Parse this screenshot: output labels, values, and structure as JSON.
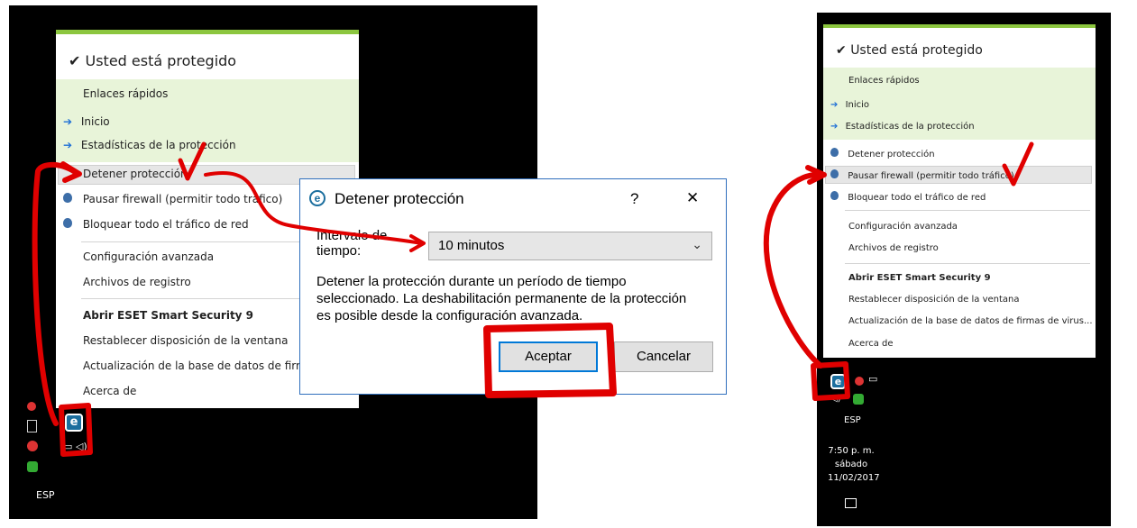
{
  "left_panel": {
    "status": "Usted está protegido",
    "quick_links_title": "Enlaces rápidos",
    "items": [
      {
        "label": "Inicio",
        "icon": "arrow-right-icon"
      },
      {
        "label": "Estadísticas de la protección",
        "icon": "arrow-right-icon"
      },
      {
        "label": "Detener protección",
        "icon": "none"
      },
      {
        "label": "Pausar firewall (permitir todo tráfico)",
        "icon": "shield-icon"
      },
      {
        "label": "Bloquear todo el tráfico de red",
        "icon": "shield-icon"
      },
      {
        "label": "Configuración avanzada"
      },
      {
        "label": "Archivos de registro"
      },
      {
        "label": "Abrir ESET Smart Security 9",
        "bold": true
      },
      {
        "label": "Restablecer disposición de la ventana"
      },
      {
        "label": "Actualización de la base de datos de firmas de"
      },
      {
        "label": "Acerca de"
      }
    ],
    "tray": {
      "language": "ESP",
      "eset_icon": "e"
    }
  },
  "dialog": {
    "title": "Detener protección",
    "help": "?",
    "close": "✕",
    "interval_label_1": "Intervalo de",
    "interval_label_2": "tiempo:",
    "interval_value": "10 minutos",
    "description_1": "Detener la protección durante un período de tiempo",
    "description_2": "seleccionado. La deshabilitación permanente de la protección",
    "description_3": "es posible desde la configuración avanzada.",
    "accept": "Aceptar",
    "cancel": "Cancelar"
  },
  "right_panel": {
    "status": "Usted está protegido",
    "quick_links_title": "Enlaces rápidos",
    "items": [
      {
        "label": "Inicio"
      },
      {
        "label": "Estadísticas de la protección"
      },
      {
        "label": "Detener protección"
      },
      {
        "label": "Pausar firewall (permitir todo tráfico)"
      },
      {
        "label": "Bloquear todo el tráfico de red"
      },
      {
        "label": "Configuración avanzada"
      },
      {
        "label": "Archivos de registro"
      },
      {
        "label": "Abrir ESET Smart Security 9",
        "bold": true
      },
      {
        "label": "Restablecer disposición de la ventana"
      },
      {
        "label": "Actualización de la base de datos de firmas de virus..."
      },
      {
        "label": "Acerca de"
      }
    ],
    "tray": {
      "language": "ESP",
      "time": "7:50 p. m.",
      "day": "sábado",
      "date": "11/02/2017"
    }
  },
  "colors": {
    "annotation_red": "#e00000",
    "eset_green": "#8cc63f",
    "link_arrow": "#1e6fd6"
  }
}
